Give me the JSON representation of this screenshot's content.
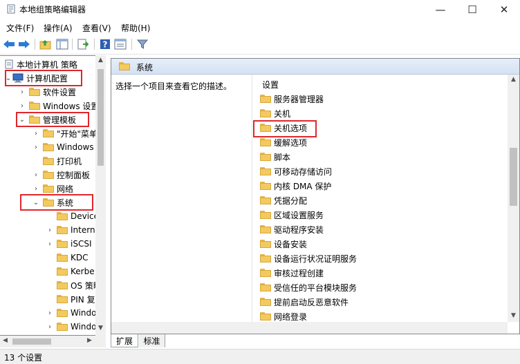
{
  "window": {
    "title": "本地组策略编辑器",
    "controls": [
      "—",
      "☐",
      "✕"
    ]
  },
  "menu": [
    "文件(F)",
    "操作(A)",
    "查看(V)",
    "帮助(H)"
  ],
  "toolbar_icons": [
    "back-arrow-icon",
    "forward-arrow-icon",
    "up-folder-icon",
    "show-hide-tree-icon",
    "export-list-icon",
    "help-icon",
    "properties-icon",
    "filter-icon"
  ],
  "tree": {
    "root": "本地计算机 策略",
    "computer_config": "计算机配置",
    "software_settings": "软件设置",
    "windows_settings": "Windows 设置",
    "admin_templates": "管理模板",
    "start_menu": "\"开始\"菜单",
    "windows_components": "Windows",
    "printers": "打印机",
    "control_panel": "控制面板",
    "network": "网络",
    "system": "系统",
    "system_children": [
      "Device",
      "Intern",
      "iSCSI",
      "KDC",
      "Kerbe",
      "OS 策略",
      "PIN 复",
      "Windo",
      "Windo"
    ]
  },
  "right": {
    "header": "系统",
    "description": "选择一个项目来查看它的描述。",
    "column_header": "设置",
    "items": [
      "服务器管理器",
      "关机",
      "关机选项",
      "缓解选项",
      "脚本",
      "可移动存储访问",
      "内核 DMA 保护",
      "凭据分配",
      "区域设置服务",
      "驱动程序安装",
      "设备安装",
      "设备运行状况证明服务",
      "审核过程创建",
      "受信任的平台模块服务",
      "提前启动反恶意软件",
      "网络登录"
    ]
  },
  "tabs": [
    "扩展",
    "标准"
  ],
  "status": "13 个设置",
  "colors": {
    "highlight": "#e0262a",
    "folder": "#f3ca5f"
  }
}
